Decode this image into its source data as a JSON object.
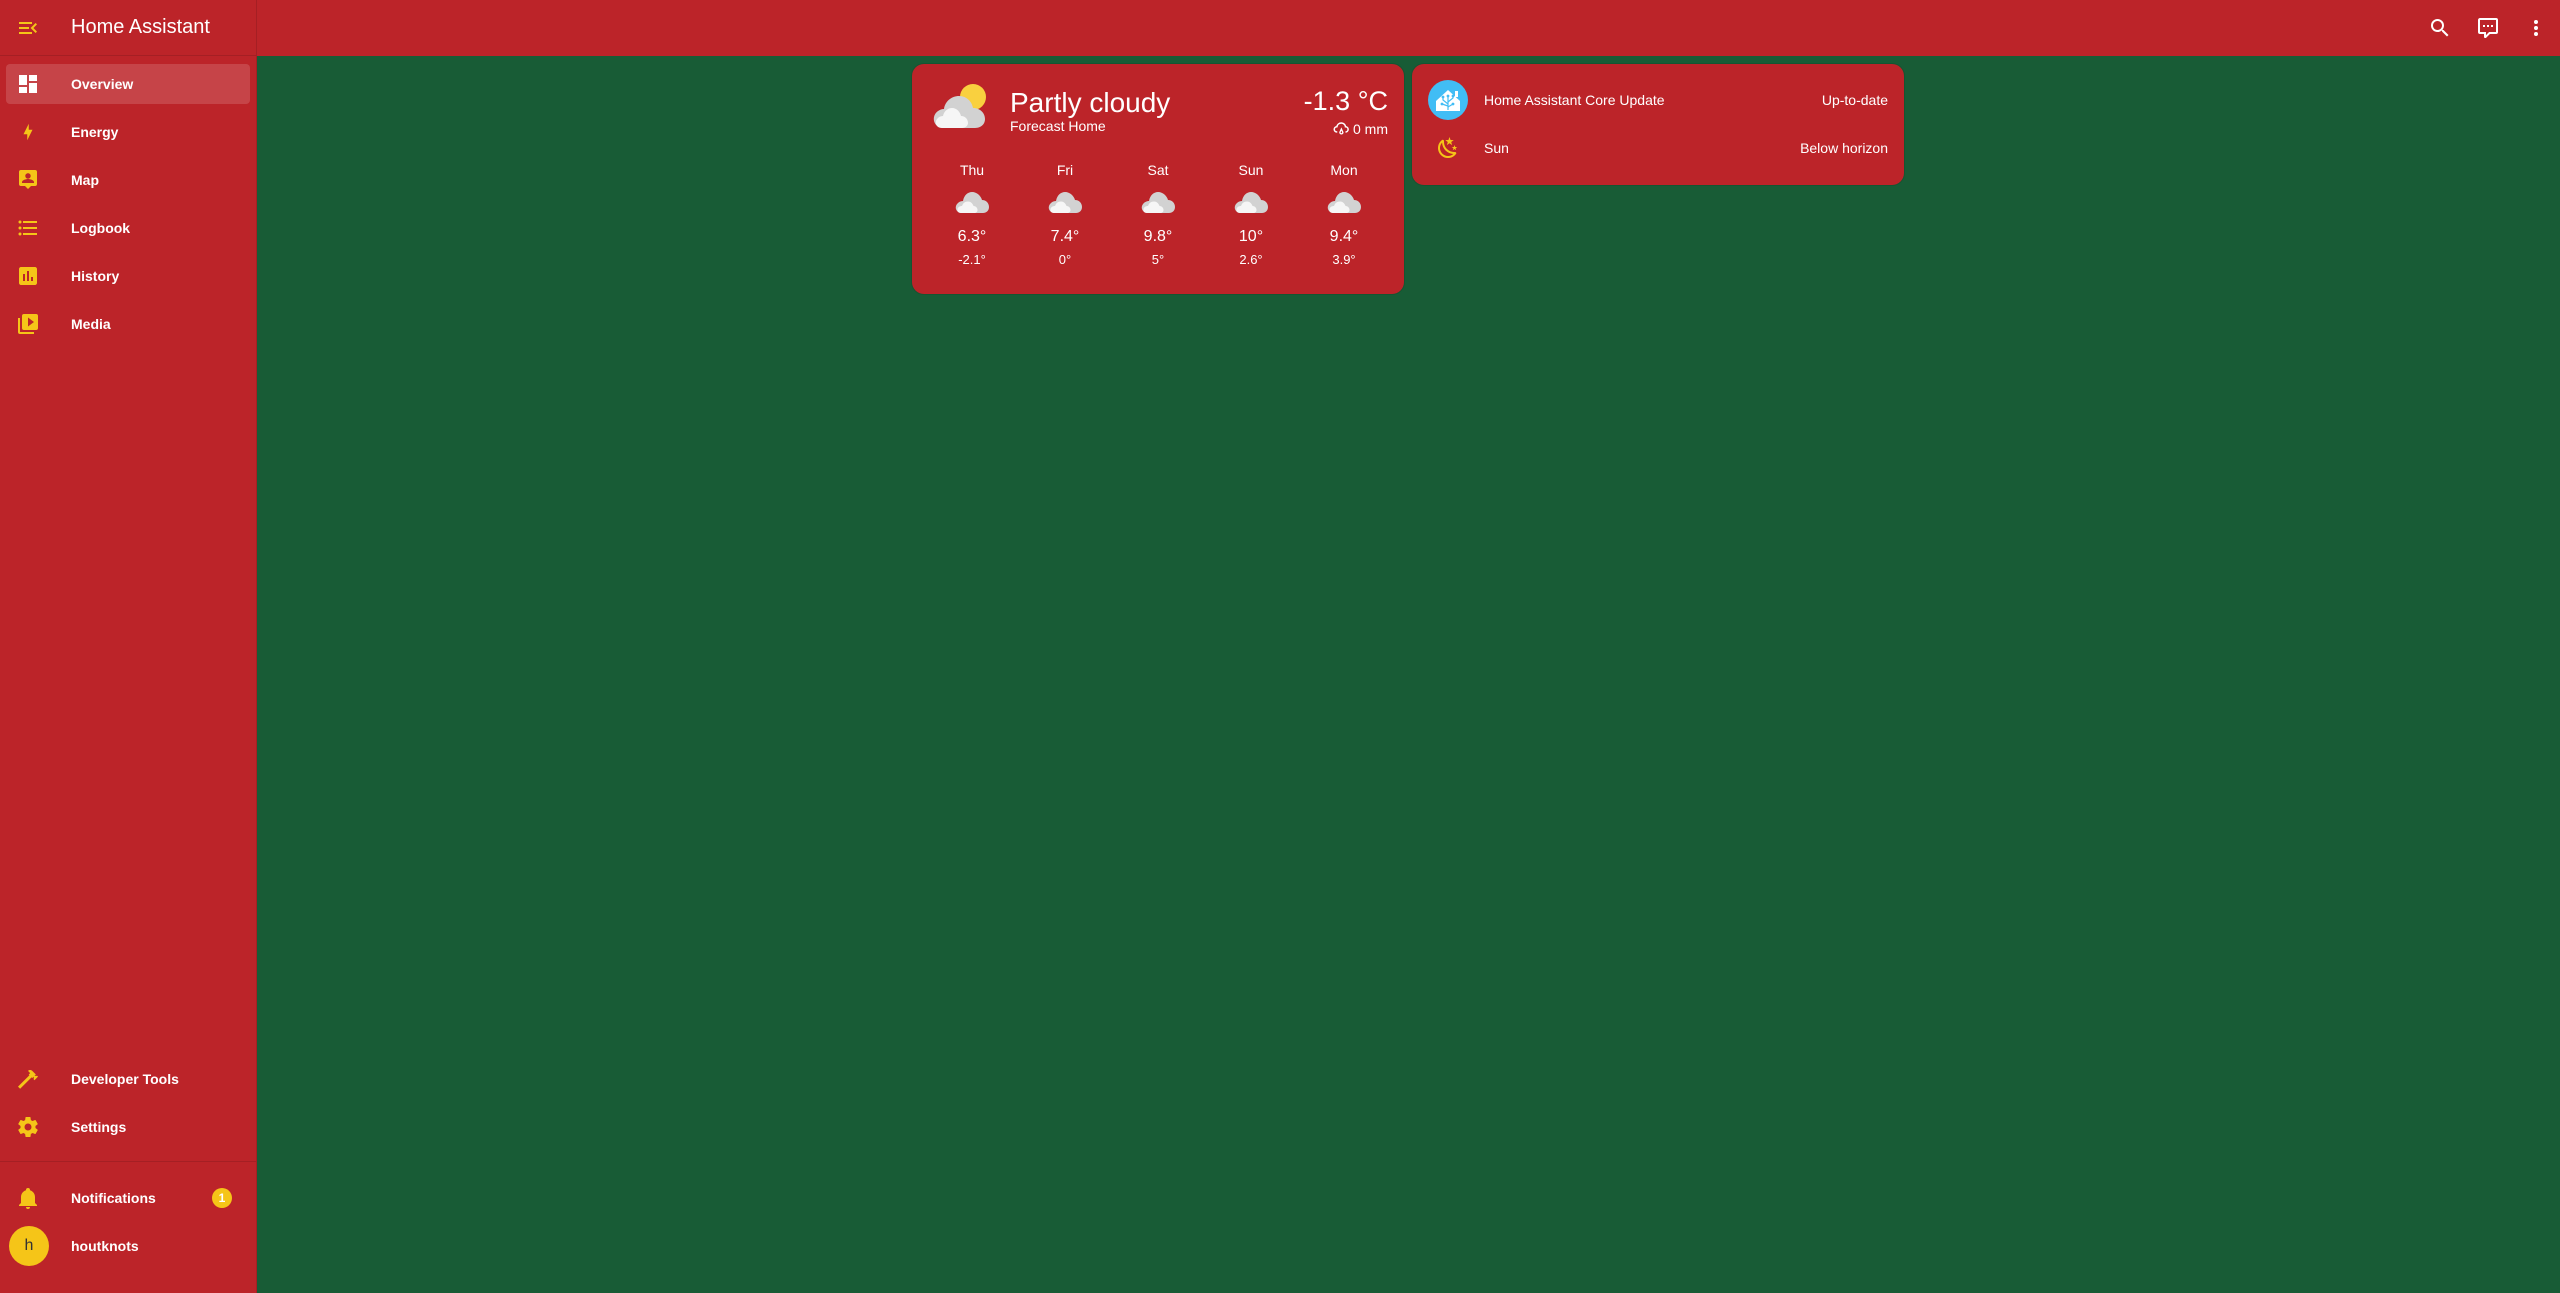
{
  "app": {
    "title": "Home Assistant"
  },
  "sidebar": {
    "items": [
      {
        "label": "Overview",
        "icon": "view-dashboard-icon",
        "active": true
      },
      {
        "label": "Energy",
        "icon": "lightning-bolt-icon"
      },
      {
        "label": "Map",
        "icon": "account-box-map-icon"
      },
      {
        "label": "Logbook",
        "icon": "format-list-bulleted-icon"
      },
      {
        "label": "History",
        "icon": "chart-box-icon"
      },
      {
        "label": "Media",
        "icon": "play-box-multiple-icon"
      }
    ],
    "bottom_items": [
      {
        "label": "Developer Tools",
        "icon": "hammer-icon"
      },
      {
        "label": "Settings",
        "icon": "cog-icon"
      }
    ],
    "notifications": {
      "label": "Notifications",
      "icon": "bell-icon",
      "count": "1"
    },
    "user": {
      "name": "houtknots",
      "initial": "h"
    }
  },
  "topbar": {
    "icons": [
      "search-icon",
      "assist-icon",
      "more-vertical-icon"
    ]
  },
  "weather": {
    "condition": "Partly cloudy",
    "name": "Forecast Home",
    "temperature": "-1.3 °C",
    "precipitation": "0 mm",
    "forecast": [
      {
        "day": "Thu",
        "high": "6.3°",
        "low": "-2.1°",
        "icon": "cloudy-icon"
      },
      {
        "day": "Fri",
        "high": "7.4°",
        "low": "0°",
        "icon": "cloudy-icon"
      },
      {
        "day": "Sat",
        "high": "9.8°",
        "low": "5°",
        "icon": "cloudy-icon"
      },
      {
        "day": "Sun",
        "high": "10°",
        "low": "2.6°",
        "icon": "cloudy-icon"
      },
      {
        "day": "Mon",
        "high": "9.4°",
        "low": "3.9°",
        "icon": "cloudy-icon"
      }
    ]
  },
  "entities": [
    {
      "name": "Home Assistant Core Update",
      "state": "Up-to-date",
      "icon": "home-assistant-logo-icon"
    },
    {
      "name": "Sun",
      "state": "Below horizon",
      "icon": "weather-night-icon"
    }
  ],
  "colors": {
    "primary": "#bc2429",
    "background": "#185c36",
    "accent": "#f5c518"
  }
}
